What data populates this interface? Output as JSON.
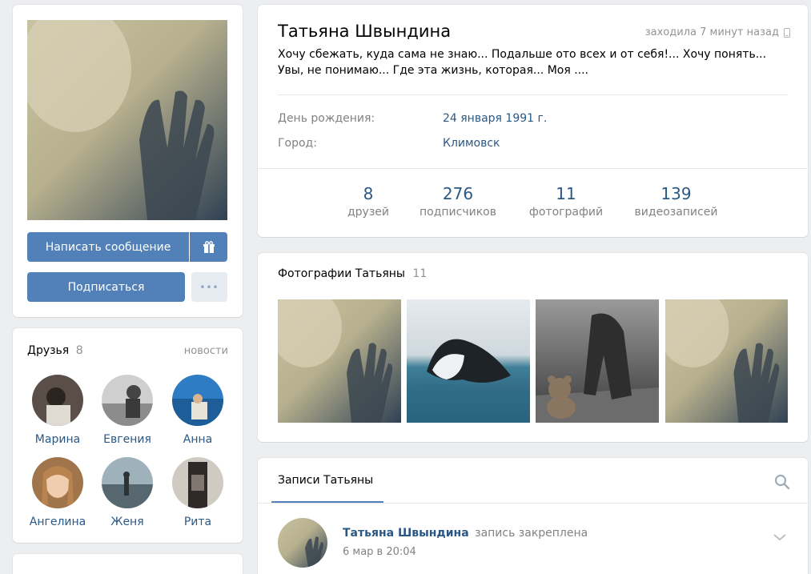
{
  "profile": {
    "name": "Татьяна Швындина",
    "last_seen": "заходила 7 минут назад",
    "status_line1": "Хочу сбежать, куда сама не знаю... Подальше ото всех и от себя!... Хочу понять...",
    "status_line2": "Увы, не понимаю... Где эта жизнь, которая... Моя ....",
    "info": [
      {
        "label": "День рождения:",
        "value": "24 января 1991 г."
      },
      {
        "label": "Город:",
        "value": "Климовск"
      }
    ],
    "counters": [
      {
        "num": "8",
        "label": "друзей"
      },
      {
        "num": "276",
        "label": "подписчиков"
      },
      {
        "num": "11",
        "label": "фотографий"
      },
      {
        "num": "139",
        "label": "видеозаписей"
      }
    ]
  },
  "actions": {
    "message": "Написать сообщение",
    "subscribe": "Подписаться",
    "more": "•••"
  },
  "friends": {
    "title": "Друзья",
    "count": "8",
    "news": "новости",
    "items": [
      {
        "name": "Марина"
      },
      {
        "name": "Евгения"
      },
      {
        "name": "Анна"
      },
      {
        "name": "Ангелина"
      },
      {
        "name": "Женя"
      },
      {
        "name": "Рита"
      }
    ]
  },
  "photos": {
    "title": "Фотографии Татьяны",
    "count": "11"
  },
  "wall": {
    "tab": "Записи Татьяны",
    "post_author": "Татьяна Швындина",
    "post_note": "запись закреплена",
    "post_date": "6 мар в 20:04"
  },
  "colors": {
    "accent": "#5181b8",
    "link": "#2a5885",
    "background": "#edeef0"
  },
  "icons": [
    "gift-icon",
    "phone-icon",
    "search-icon",
    "chevron-down-icon"
  ]
}
